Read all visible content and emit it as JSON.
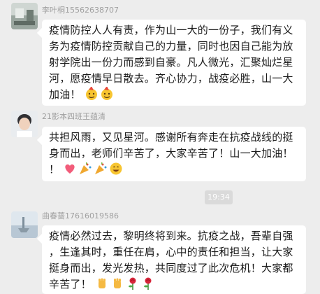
{
  "messages": [
    {
      "sender": "李叶桐15562638707",
      "lines": [
        "疫情防控人人有责，作为山一大的一份子，我们有义",
        "务为疫情防控贡献自己的力量，同时也因自己能为放",
        "射学院出一份力而感到自豪。凡人微光，汇聚灿烂星",
        "河，愿疫情早日散去。齐心协力，战疫必胜，山一大",
        "加油！"
      ],
      "emojis": [
        "party-face-emoji",
        "party-face-emoji"
      ]
    },
    {
      "sender": "21影本四班王蕴清",
      "lines": [
        "共担风雨，又见星河。感谢所有奔走在抗疫战线的挺",
        "身而出，老师们辛苦了，大家辛苦了！山一大加油！",
        "！"
      ],
      "emojis": [
        "heart-emoji",
        "party-popper-emoji",
        "party-popper-emoji",
        "smile-emoji"
      ]
    },
    {
      "sender": "曲春蔷17616019586",
      "lines": [
        "疫情必然过去，黎明终将到来。抗疫之战，吾辈自强",
        "，生逢其时，重任在肩，心中的责任和担当，让大家",
        "挺身而出，发光发热，共同度过了此次危机！大家都",
        "辛苦了！"
      ],
      "emojis": [
        "raised-fist-emoji",
        "raised-fist-emoji",
        "rose-emoji",
        "rose-emoji"
      ]
    }
  ],
  "timestamp": "19:34",
  "colors": {
    "background": "#ededed",
    "bubble": "#ffffff",
    "sender_text": "#a0a0a0",
    "time_chip": "#dadada"
  }
}
